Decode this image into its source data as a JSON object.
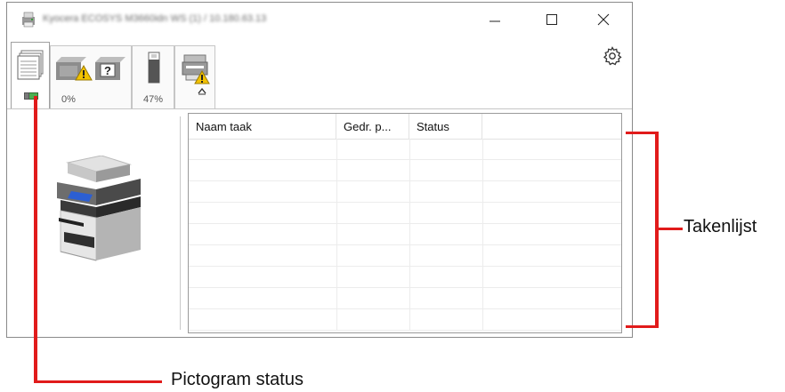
{
  "window": {
    "title": "Kyocera ECOSYS M3660idn WS (1) / 10.180.63.13",
    "controls": {
      "minimize": "minimize",
      "maximize": "maximize",
      "close": "close"
    }
  },
  "tabs": [
    {
      "id": "job-list",
      "icon": "document-stack-icon",
      "status_icon": "green-status-indicator"
    },
    {
      "id": "paper-tray",
      "icon": "tray-warning-icon",
      "level_text": "0%"
    },
    {
      "id": "toner",
      "icon": "toner-cartridge-icon",
      "level_text": "47%"
    },
    {
      "id": "device-status",
      "icon": "printer-warning-icon"
    }
  ],
  "job_list": {
    "columns": [
      "Naam taak",
      "Gedr. p...",
      "Status",
      ""
    ],
    "rows": []
  },
  "callouts": {
    "job_list_label": "Takenlijst",
    "status_icon_label": "Pictogram status"
  },
  "colors": {
    "callout_red": "#e11b1b",
    "warning_yellow": "#f2c200",
    "status_green": "#4caf50"
  }
}
